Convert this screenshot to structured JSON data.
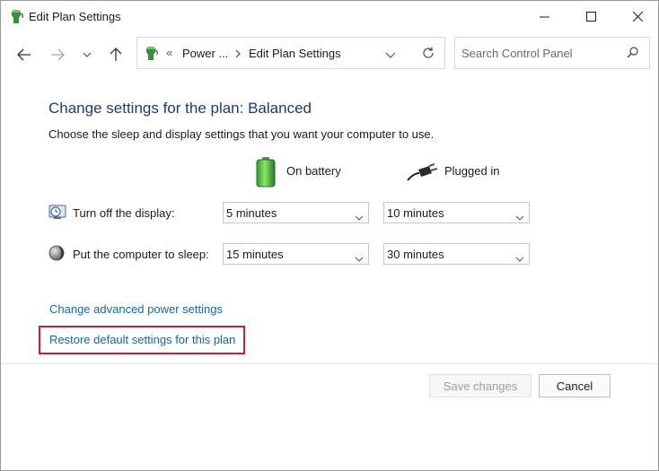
{
  "window": {
    "title": "Edit Plan Settings",
    "app_icon": "power-options-icon"
  },
  "nav": {
    "breadcrumb": {
      "overflow": "«",
      "parent": "Power ...",
      "current": "Edit Plan Settings"
    },
    "search": {
      "placeholder": "Search Control Panel",
      "value": ""
    }
  },
  "main": {
    "heading": "Change settings for the plan: Balanced",
    "description": "Choose the sleep and display settings that you want your computer to use.",
    "columns": {
      "battery": {
        "label": "On battery",
        "icon": "battery-icon"
      },
      "plugged": {
        "label": "Plugged in",
        "icon": "power-plug-icon"
      }
    },
    "settings": [
      {
        "label": "Turn off the display:",
        "icon": "display-clock-icon",
        "battery": "5 minutes",
        "plugged": "10 minutes"
      },
      {
        "label": "Put the computer to sleep:",
        "icon": "sleep-moon-icon",
        "battery": "15 minutes",
        "plugged": "30 minutes"
      }
    ],
    "links": {
      "advanced": "Change advanced power settings",
      "restore": "Restore default settings for this plan"
    }
  },
  "footer": {
    "save_label": "Save changes",
    "save_enabled": false,
    "cancel_label": "Cancel"
  },
  "colors": {
    "heading": "#1e3a6e",
    "link": "#1a66a3",
    "highlight_box": "#c8202d"
  }
}
